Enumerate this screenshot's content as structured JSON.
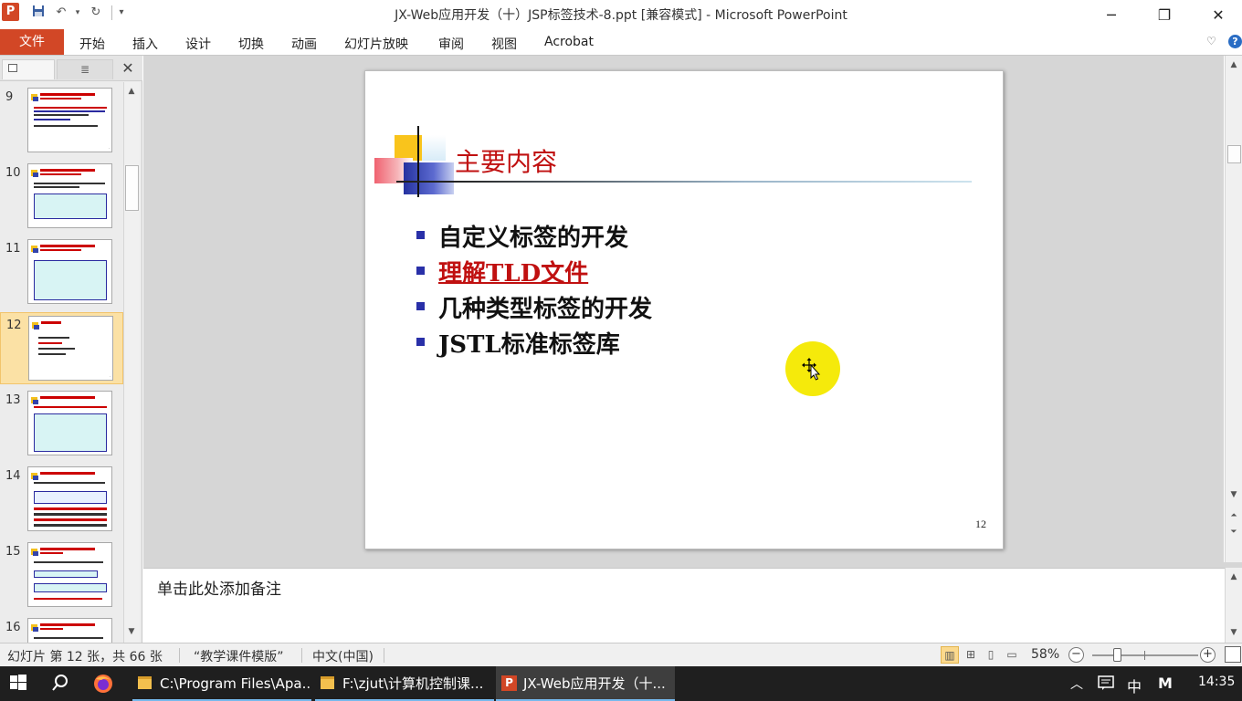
{
  "window": {
    "title": "JX-Web应用开发（十）JSP标签技术-8.ppt [兼容模式] - Microsoft PowerPoint",
    "app_icon": "P",
    "controls": {
      "minimize": "─",
      "restore": "❐",
      "close": "✕"
    }
  },
  "quick_access": {
    "save_icon": "save-icon",
    "undo_icon": "undo-icon",
    "redo_icon": "redo-icon",
    "customize_icon": "customize-qat-icon"
  },
  "ribbon": {
    "file_tab": "文件",
    "tabs": [
      "开始",
      "插入",
      "设计",
      "切换",
      "动画",
      "幻灯片放映",
      "审阅",
      "视图",
      "Acrobat"
    ],
    "help": "?"
  },
  "left_panel": {
    "tabs_icon": "slides-tab-icon",
    "outline_icon": "outline-tab-icon",
    "close": "✕",
    "thumbnails": [
      {
        "num": "9"
      },
      {
        "num": "10"
      },
      {
        "num": "11"
      },
      {
        "num": "12",
        "selected": true
      },
      {
        "num": "13"
      },
      {
        "num": "14"
      },
      {
        "num": "15"
      },
      {
        "num": "16"
      }
    ]
  },
  "slide": {
    "title": "主要内容",
    "bullets": [
      {
        "text": "自定义标签的开发",
        "highlight": false
      },
      {
        "text": "理解TLD文件",
        "highlight": true
      },
      {
        "text": "几种类型标签的开发",
        "highlight": false
      },
      {
        "text": "JSTL标准标签库",
        "highlight": false
      }
    ],
    "page_number": "12",
    "colors": {
      "title": "#c01010",
      "bullet": "#2930a8",
      "highlight": "#c01010",
      "pointer": "#f5ea0b"
    }
  },
  "notes": {
    "placeholder": "单击此处添加备注"
  },
  "statusbar": {
    "slide_info": "幻灯片 第 12 张，共 66 张",
    "theme": "“教学课件模版”",
    "language": "中文(中国)",
    "zoom": "58%",
    "zoom_fraction": 0.58,
    "zoom_minus": "−",
    "zoom_plus": "+"
  },
  "taskbar": {
    "apps": [
      {
        "label": "C:\\Program Files\\Apa...",
        "icon": "folder-icon",
        "active": false
      },
      {
        "label": "F:\\zjut\\计算机控制课...",
        "icon": "folder-icon",
        "active": false
      },
      {
        "label": "JX-Web应用开发（十...",
        "icon": "powerpoint-icon",
        "active": true
      }
    ],
    "ime": "中",
    "ime2": "M",
    "time": "14:35"
  }
}
